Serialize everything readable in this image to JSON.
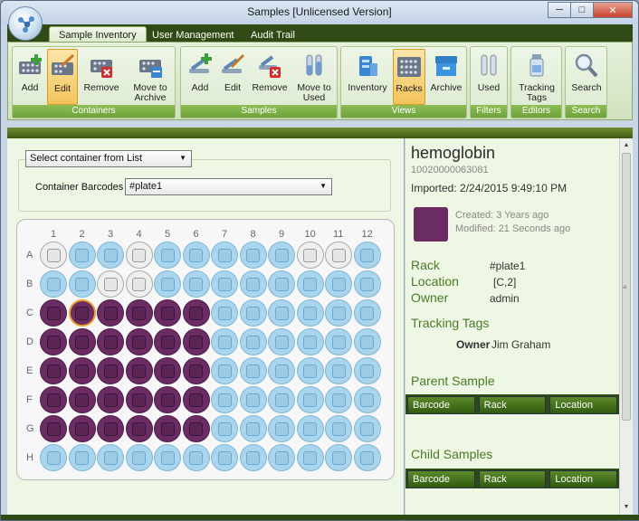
{
  "window": {
    "title": "Samples [Unlicensed Version]",
    "controls": [
      "minimize",
      "maximize",
      "close"
    ]
  },
  "tabs": [
    {
      "label": "Sample Inventory",
      "active": true
    },
    {
      "label": "User Management",
      "active": false
    },
    {
      "label": "Audit Trail",
      "active": false
    }
  ],
  "ribbon": {
    "groups": [
      {
        "label": "Containers",
        "buttons": [
          "Add",
          "Edit",
          "Remove",
          "Move to Archive"
        ]
      },
      {
        "label": "Samples",
        "buttons": [
          "Add",
          "Edit",
          "Remove",
          "Move to Used"
        ]
      },
      {
        "label": "Views",
        "buttons": [
          "Inventory",
          "Racks",
          "Archive"
        ]
      },
      {
        "label": "Filters",
        "buttons": [
          "Used"
        ]
      },
      {
        "label": "Editors",
        "buttons": [
          "Tracking Tags"
        ]
      },
      {
        "label": "Search",
        "buttons": [
          "Search"
        ]
      }
    ]
  },
  "left": {
    "container_select": "Select container from List",
    "barcode_label": "Container Barcodes",
    "barcode_value": "#plate1"
  },
  "plate": {
    "columns": [
      "1",
      "2",
      "3",
      "4",
      "5",
      "6",
      "7",
      "8",
      "9",
      "10",
      "11",
      "12"
    ],
    "rows": [
      {
        "label": "A",
        "wells": [
          "g",
          "b",
          "b",
          "g",
          "b",
          "b",
          "b",
          "b",
          "b",
          "g",
          "g",
          "b"
        ]
      },
      {
        "label": "B",
        "wells": [
          "b",
          "b",
          "g",
          "g",
          "b",
          "b",
          "b",
          "b",
          "b",
          "b",
          "b",
          "b"
        ]
      },
      {
        "label": "C",
        "wells": [
          "f",
          "s",
          "f",
          "f",
          "f",
          "f",
          "b",
          "b",
          "b",
          "b",
          "b",
          "b"
        ]
      },
      {
        "label": "D",
        "wells": [
          "f",
          "f",
          "f",
          "f",
          "f",
          "f",
          "b",
          "b",
          "b",
          "b",
          "b",
          "b"
        ]
      },
      {
        "label": "E",
        "wells": [
          "f",
          "f",
          "f",
          "f",
          "f",
          "f",
          "b",
          "b",
          "b",
          "b",
          "b",
          "b"
        ]
      },
      {
        "label": "F",
        "wells": [
          "f",
          "f",
          "f",
          "f",
          "f",
          "f",
          "b",
          "b",
          "b",
          "b",
          "b",
          "b"
        ]
      },
      {
        "label": "G",
        "wells": [
          "f",
          "f",
          "f",
          "f",
          "f",
          "f",
          "b",
          "b",
          "b",
          "b",
          "b",
          "b"
        ]
      },
      {
        "label": "H",
        "wells": [
          "b",
          "b",
          "b",
          "b",
          "b",
          "b",
          "b",
          "b",
          "b",
          "b",
          "b",
          "b"
        ]
      }
    ]
  },
  "details": {
    "name": "hemoglobin",
    "id": "10020000063081",
    "imported": "Imported: 2/24/2015 9:49:10 PM",
    "created": "Created: 3 Years ago",
    "modified": "Modified: 21 Seconds ago",
    "swatch_color": "#6b2c64",
    "rack_label": "Rack",
    "rack_value": "#plate1",
    "location_label": "Location",
    "location_value": "[C,2]",
    "owner_label": "Owner",
    "owner_value": "admin",
    "tracking_tags_title": "Tracking Tags",
    "tag_key": "Owner",
    "tag_value": "Jim Graham",
    "parent_title": "Parent Sample",
    "child_title": "Child Samples",
    "columns": [
      "Barcode",
      "Rack",
      "Location"
    ]
  }
}
